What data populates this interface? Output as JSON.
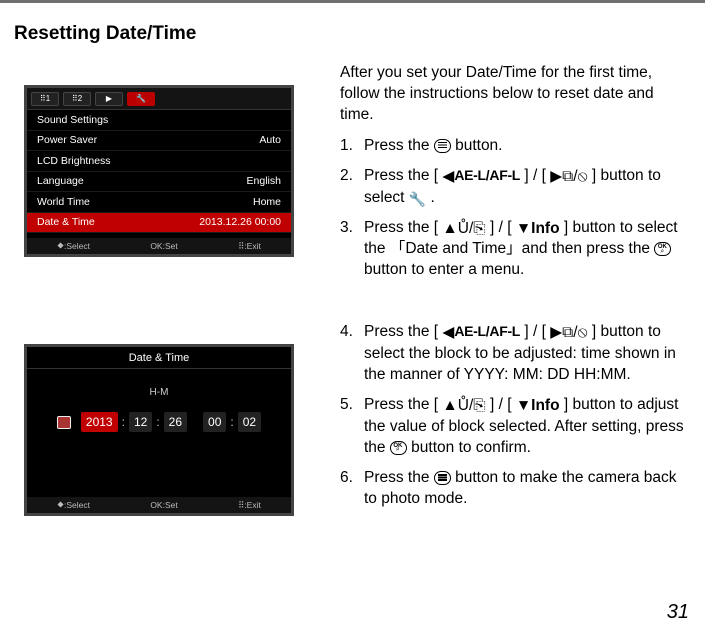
{
  "page": {
    "title": "Resetting Date/Time",
    "number": "31"
  },
  "intro": "After you set your Date/Time for the first time, follow the instructions below to reset date and time.",
  "steps": [
    {
      "n": "1.",
      "a": "Press the ",
      "b": " button."
    },
    {
      "n": "2.",
      "a": "Press the [ ",
      "b": " ] / [ ",
      "c": " ] button to select ",
      "d": " ."
    },
    {
      "n": "3.",
      "a": "Press the [ ",
      "b": " ] / [ ",
      "c": " ] button to select the 「Date and Time」and then press the ",
      "d": " button to enter a menu."
    }
  ],
  "steps2": [
    {
      "n": "4.",
      "a": "Press the [ ",
      "b": " ] / [ ",
      "c": " ] button to select the block to be adjusted: time shown in the manner of YYYY: MM: DD HH:MM."
    },
    {
      "n": "5.",
      "a": "Press the [ ",
      "b": " ] / [ ",
      "c": " ] button to adjust the value of block selected. After setting, press the ",
      "d": " button to confirm."
    },
    {
      "n": "6.",
      "a": "Press the ",
      "b": " button to make the camera back to photo mode."
    }
  ],
  "icons": {
    "left_label": "AE-L/AF-L",
    "right_label": "",
    "info_label": "Info"
  },
  "lcd1": {
    "tabs": [
      "⠿1",
      "⠿2",
      "▶",
      "🔧"
    ],
    "rows": [
      {
        "label": "Sound Settings",
        "value": ""
      },
      {
        "label": "Power Saver",
        "value": "Auto"
      },
      {
        "label": "LCD Brightness",
        "value": ""
      },
      {
        "label": "Language",
        "value": "English"
      },
      {
        "label": "World Time",
        "value": "Home"
      },
      {
        "label": "Date & Time",
        "value": "2013.12.26 00:00",
        "sel": true
      }
    ],
    "bbar": {
      "l": "⯁:Select",
      "m": "OK:Set",
      "r": "⠿:Exit"
    }
  },
  "lcd2": {
    "title": "Date & Time",
    "hm": "H-M",
    "fields": [
      {
        "v": "2013",
        "sel": true
      },
      {
        "v": ":",
        "colon": true
      },
      {
        "v": "12"
      },
      {
        "v": ":",
        "colon": true
      },
      {
        "v": "26"
      },
      {
        "v": " ",
        "gap": true
      },
      {
        "v": "00"
      },
      {
        "v": ":",
        "colon": true
      },
      {
        "v": "02"
      }
    ],
    "bbar": {
      "l": "⯁:Select",
      "m": "OK:Set",
      "r": "⠿:Exit"
    }
  }
}
